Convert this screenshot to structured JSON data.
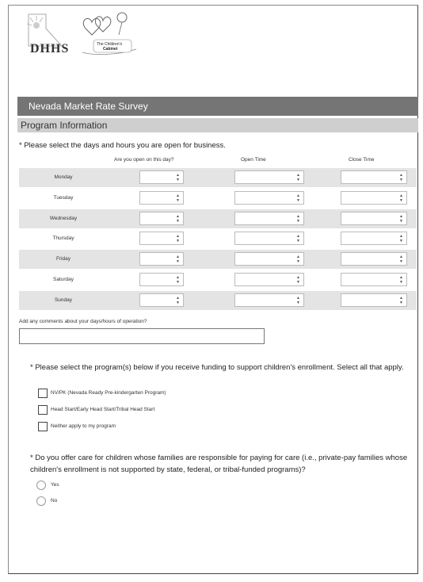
{
  "logo": {
    "brand": "DHHS",
    "partner": "The Children's Cabinet"
  },
  "header": {
    "title": "Nevada Market Rate Survey"
  },
  "section": {
    "title": "Program Information"
  },
  "schedule": {
    "question": "* Please select the days and hours you are open for business.",
    "columns": {
      "open_day": "Are you open on this day?",
      "open_time": "Open Time",
      "close_time": "Close Time"
    },
    "days": [
      "Monday",
      "Tuesday",
      "Wednesday",
      "Thursday",
      "Friday",
      "Saturday",
      "Sunday"
    ],
    "comments_label": "Add any comments about your days/hours of operation?",
    "comments_value": ""
  },
  "funding": {
    "question": "* Please select the program(s) below if you receive funding to support children's enrollment. Select all that apply.",
    "options": [
      "NV/PK (Nevada Ready Pre-kindergarten Program)",
      "Head Start/Early Head Start/Tribal Head Start",
      "Neither apply to my program"
    ]
  },
  "private_pay": {
    "question": "* Do you offer care for children whose families are responsible for paying for care (i.e., private-pay families whose children's enrollment is not supported by state, federal, or tribal-funded programs)?",
    "options": [
      "Yes",
      "No"
    ]
  },
  "colors": {
    "header_bg": "#757575",
    "section_bg": "#cfcfcf",
    "row_shade": "#e4e4e4"
  }
}
